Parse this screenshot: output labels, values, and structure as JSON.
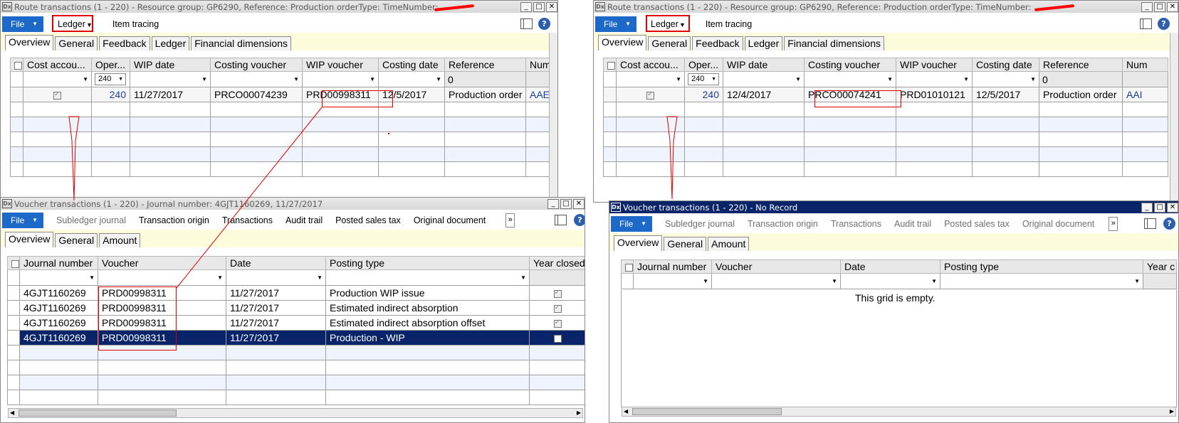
{
  "left_route": {
    "title": "Route transactions (1 - 220) - Resource group: GP6290, Reference: Production orderType: TimeNumber:",
    "file_label": "File",
    "ledger_label": "Ledger",
    "item_tracing_label": "Item tracing",
    "tabs": [
      "Overview",
      "General",
      "Feedback",
      "Ledger",
      "Financial dimensions"
    ],
    "columns": [
      "Cost accou...",
      "Oper...",
      "WIP date",
      "Costing voucher",
      "WIP voucher",
      "Costing date",
      "Reference",
      "Num"
    ],
    "filter_oper": "240",
    "filter_reference": "0",
    "row": {
      "oper": "240",
      "wip_date": "11/27/2017",
      "costing_voucher": "PRCO00074239",
      "wip_voucher": "PRD00998311",
      "costing_date": "12/5/2017",
      "reference": "Production order",
      "num": "AAE"
    }
  },
  "right_route": {
    "title": "Route transactions (1 - 220) - Resource group: GP6290, Reference: Production orderType: TimeNumber:",
    "file_label": "File",
    "ledger_label": "Ledger",
    "item_tracing_label": "Item tracing",
    "tabs": [
      "Overview",
      "General",
      "Feedback",
      "Ledger",
      "Financial dimensions"
    ],
    "columns": [
      "Cost accou...",
      "Oper...",
      "WIP date",
      "Costing voucher",
      "WIP voucher",
      "Costing date",
      "Reference",
      "Num"
    ],
    "filter_oper": "240",
    "filter_reference": "0",
    "row": {
      "oper": "240",
      "wip_date": "12/4/2017",
      "costing_voucher": "PRCO00074241",
      "wip_voucher": "PRD01010121",
      "costing_date": "12/5/2017",
      "reference": "Production order",
      "num": "AAI"
    }
  },
  "left_voucher": {
    "title": "Voucher transactions (1 - 220) - Journal number: 4GJT1160269, 11/27/2017",
    "file_label": "File",
    "toolbar": [
      "Subledger journal",
      "Transaction origin",
      "Transactions",
      "Audit trail",
      "Posted sales tax",
      "Original document"
    ],
    "tabs": [
      "Overview",
      "General",
      "Amount"
    ],
    "columns": [
      "Journal number",
      "Voucher",
      "Date",
      "Posting type",
      "Year closed"
    ],
    "rows": [
      {
        "journal": "4GJT1160269",
        "voucher": "PRD00998311",
        "date": "11/27/2017",
        "posting_type": "Production WIP issue"
      },
      {
        "journal": "4GJT1160269",
        "voucher": "PRD00998311",
        "date": "11/27/2017",
        "posting_type": "Estimated indirect absorption"
      },
      {
        "journal": "4GJT1160269",
        "voucher": "PRD00998311",
        "date": "11/27/2017",
        "posting_type": "Estimated indirect absorption offset"
      },
      {
        "journal": "4GJT1160269",
        "voucher": "PRD00998311",
        "date": "11/27/2017",
        "posting_type": "Production - WIP"
      }
    ]
  },
  "right_voucher": {
    "title": "Voucher transactions (1 - 220) - No Record",
    "file_label": "File",
    "toolbar": [
      "Subledger journal",
      "Transaction origin",
      "Transactions",
      "Audit trail",
      "Posted sales tax",
      "Original document"
    ],
    "tabs": [
      "Overview",
      "General",
      "Amount"
    ],
    "columns": [
      "Journal number",
      "Voucher",
      "Date",
      "Posting type",
      "Year c"
    ],
    "empty_message": "This grid is empty."
  },
  "colors": {
    "file_button": "#1c69c9",
    "active_title": "#0a246a",
    "tab_band": "#fcfcdc",
    "annotation": "#e00000",
    "selected_row": "#0a246a"
  }
}
